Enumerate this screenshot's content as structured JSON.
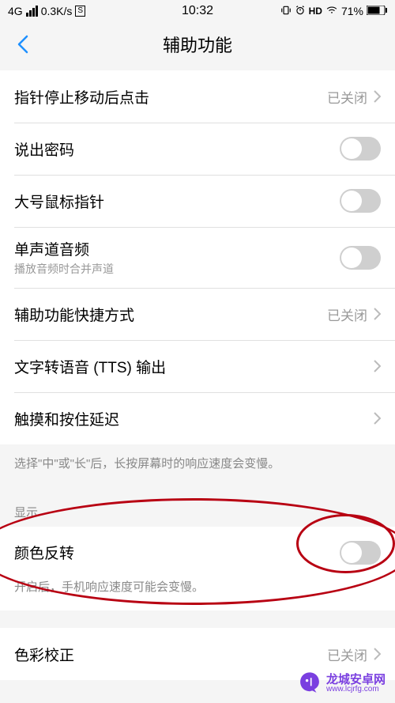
{
  "status": {
    "net": "4G",
    "speed": "0.3K/s",
    "sim": "S",
    "time": "10:32",
    "hd": "HD",
    "battery": "71%"
  },
  "header": {
    "title": "辅助功能"
  },
  "rows": {
    "pointer_click": {
      "label": "指针停止移动后点击",
      "value": "已关闭"
    },
    "speak_pw": {
      "label": "说出密码"
    },
    "large_cursor": {
      "label": "大号鼠标指针"
    },
    "mono_audio": {
      "label": "单声道音频",
      "sub": "播放音频时合并声道"
    },
    "shortcut": {
      "label": "辅助功能快捷方式",
      "value": "已关闭"
    },
    "tts": {
      "label": "文字转语音 (TTS) 输出"
    },
    "touch_hold": {
      "label": "触摸和按住延迟"
    },
    "touch_hold_hint": "选择\"中\"或\"长\"后，长按屏幕时的响应速度会变慢。",
    "display_section": "显示",
    "color_invert": {
      "label": "颜色反转",
      "hint": "开启后，手机响应速度可能会变慢。"
    },
    "color_correct": {
      "label": "色彩校正",
      "value": "已关闭"
    }
  },
  "watermark": {
    "title": "龙城安卓网",
    "url": "www.lcjrfg.com"
  }
}
